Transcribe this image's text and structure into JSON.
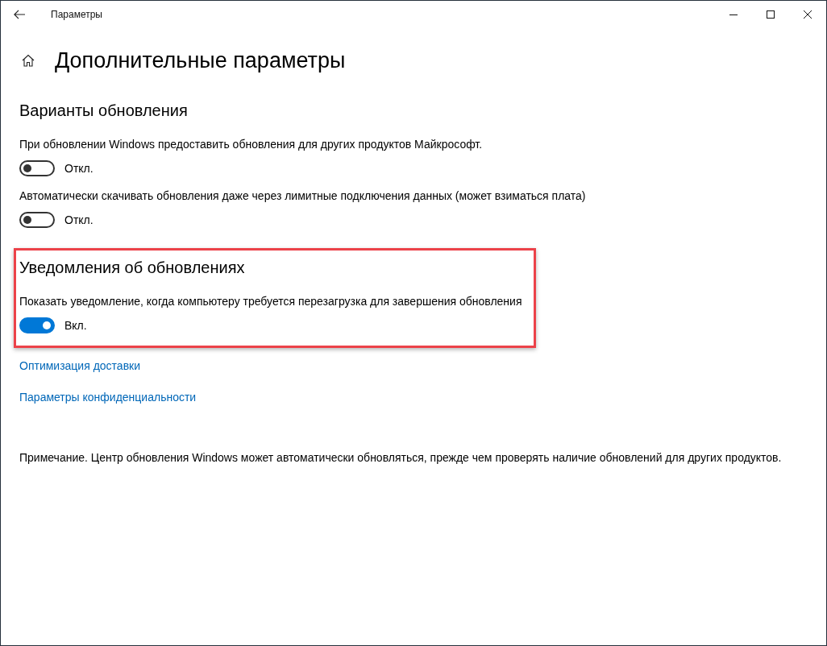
{
  "window": {
    "title": "Параметры"
  },
  "page": {
    "title": "Дополнительные параметры"
  },
  "sections": [
    {
      "heading": "Варианты обновления",
      "highlighted": false,
      "settings": [
        {
          "label": "При обновлении Windows предоставить обновления для других продуктов Майкрософт.",
          "on": false,
          "state_text": "Откл."
        },
        {
          "label": "Автоматически скачивать обновления даже через лимитные подключения данных (может взиматься плата)",
          "on": false,
          "state_text": "Откл."
        }
      ]
    },
    {
      "heading": "Уведомления об обновлениях",
      "highlighted": true,
      "settings": [
        {
          "label": "Показать уведомление, когда компьютеру требуется перезагрузка для завершения обновления",
          "on": true,
          "state_text": "Вкл."
        }
      ]
    }
  ],
  "links": [
    "Оптимизация доставки",
    "Параметры конфиденциальности"
  ],
  "note": "Примечание. Центр обновления Windows может автоматически обновляться, прежде чем проверять наличие обновлений для других продуктов."
}
